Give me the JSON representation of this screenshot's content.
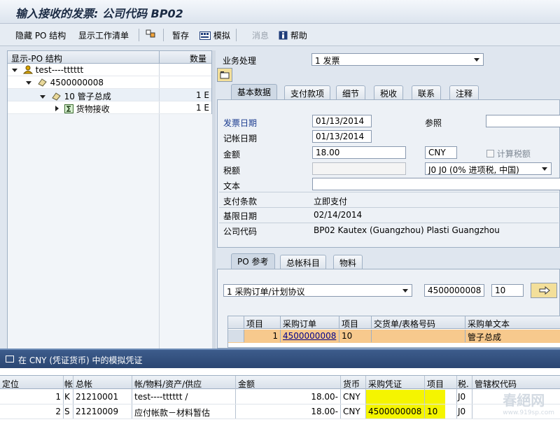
{
  "title": "输入接收的发票: 公司代码 BP02",
  "toolbar": {
    "hide_po": "隐藏 PO 结构",
    "show_worklist": "显示工作清单",
    "hold": "暂存",
    "simulate": "模拟",
    "messages": "消息",
    "help": "帮助"
  },
  "tree": {
    "col_structure": "显示-PO 结构",
    "col_qty": "数量",
    "rows": [
      {
        "label": "test----tttttt",
        "qty": ""
      },
      {
        "label": "4500000008",
        "qty": ""
      },
      {
        "label": "10 管子总成",
        "qty": "1 E"
      },
      {
        "label": "货物接收",
        "qty": "1 E"
      }
    ]
  },
  "transaction": {
    "label": "业务处理",
    "value": "1 发票"
  },
  "header_tabs": [
    "基本数据",
    "支付款项",
    "细节",
    "税收",
    "联系",
    "注释"
  ],
  "basic": {
    "invoice_date_label": "发票日期",
    "invoice_date": "01/13/2014",
    "reference_label": "参照",
    "reference": "",
    "posting_date_label": "记帐日期",
    "posting_date": "01/13/2014",
    "amount_label": "金额",
    "amount": "18.00",
    "currency": "CNY",
    "calc_tax_label": "计算税额",
    "tax_label": "税额",
    "tax_amount": "",
    "tax_code": "J0 J0 (0% 进项税, 中国)",
    "text_label": "文本",
    "text": "",
    "payment_terms_label": "支付条款",
    "payment_terms": "立即支付",
    "baseline_label": "基限日期",
    "baseline_date": "02/14/2014",
    "company_label": "公司代码",
    "company": "BP02 Kautex (Guangzhou) Plasti Guangzhou"
  },
  "po_tabs": [
    "PO 参考",
    "总帐科目",
    "物料"
  ],
  "po_ref": {
    "type": "1 采购订单/计划协议",
    "po_number": "4500000008",
    "item": "10"
  },
  "po_table": {
    "headers": [
      "项目",
      "采购订单",
      "项目",
      "交货单/表格号码",
      "采购单文本"
    ],
    "row": {
      "item": "1",
      "po": "4500000008",
      "po_item": "10",
      "delivery": "",
      "text": "管子总成"
    }
  },
  "popup": {
    "title": "在 CNY (凭证货币) 中的模拟凭证",
    "headers": [
      "定位",
      "帐",
      "总帐",
      "帐/物料/资产/供应",
      "金额",
      "货币",
      "采购凭证",
      "项目",
      "税.",
      "管辖权代码"
    ],
    "rows": [
      {
        "pos": "1",
        "key": "K",
        "gl": "21210001",
        "desc": "test----tttttt /",
        "amount": "18.00-",
        "cur": "CNY",
        "po": "",
        "item": "",
        "tax": "J0",
        "jur": ""
      },
      {
        "pos": "2",
        "key": "S",
        "gl": "21210009",
        "desc": "应付帐款－材料暂估",
        "amount": "18.00-",
        "cur": "CNY",
        "po": "4500000008",
        "item": "10",
        "tax": "J0",
        "jur": ""
      }
    ]
  },
  "watermark": {
    "text": "春絕网",
    "url": "www.919sp.com"
  },
  "colors": {
    "selected_row": "#f7c98d",
    "highlight": "#f5f500",
    "popup_title": "#2a4672"
  }
}
